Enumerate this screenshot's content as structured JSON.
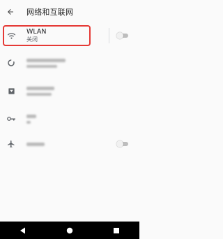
{
  "header": {
    "title": "网络和互联网",
    "back_icon": "arrow-back-icon"
  },
  "items": [
    {
      "label": "WLAN",
      "status": "关闭",
      "icon": "wifi-icon",
      "has_toggle": true,
      "toggle_on": false
    },
    {
      "label": "",
      "status": "",
      "icon": "data-usage-icon"
    },
    {
      "label": "",
      "status": "",
      "icon": "sim-card-icon"
    },
    {
      "label": "",
      "status": "",
      "icon": "vpn-key-icon"
    },
    {
      "label": "",
      "status": "",
      "icon": "airplane-icon",
      "has_toggle": true,
      "toggle_on": false
    }
  ],
  "navbar": {
    "back": "back-icon",
    "home": "home-icon",
    "recents": "recents-icon"
  },
  "colors": {
    "highlight": "#e53935",
    "background": "#fafafa",
    "navbar": "#000000"
  }
}
